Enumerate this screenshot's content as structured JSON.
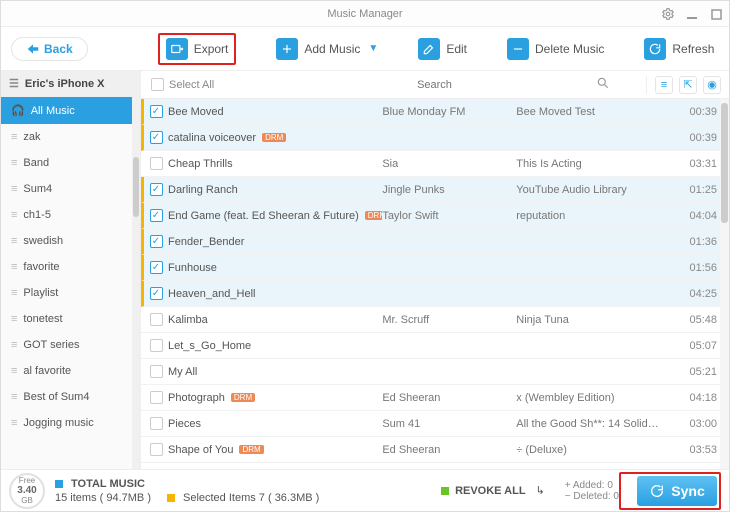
{
  "titlebar": {
    "title": "Music Manager"
  },
  "toolbar": {
    "back": "Back",
    "items": [
      {
        "label": "Export"
      },
      {
        "label": "Add Music"
      },
      {
        "label": "Edit"
      },
      {
        "label": "Delete Music"
      },
      {
        "label": "Refresh"
      }
    ]
  },
  "sidebar": {
    "device": "Eric's iPhone X",
    "items": [
      {
        "label": "All Music",
        "active": true,
        "kind": "music"
      },
      {
        "label": "zak"
      },
      {
        "label": "Band"
      },
      {
        "label": "Sum4"
      },
      {
        "label": "ch1-5"
      },
      {
        "label": "swedish"
      },
      {
        "label": "favorite"
      },
      {
        "label": "Playlist"
      },
      {
        "label": "tonetest"
      },
      {
        "label": "GOT series"
      },
      {
        "label": "al favorite"
      },
      {
        "label": "Best of Sum4"
      },
      {
        "label": "Jogging music"
      }
    ]
  },
  "table": {
    "select_all": "Select All",
    "search_placeholder": "Search",
    "rows": [
      {
        "checked": true,
        "drm": false,
        "title": "Bee Moved",
        "artist": "Blue Monday FM",
        "album": "Bee Moved Test",
        "time": "00:39"
      },
      {
        "checked": true,
        "drm": true,
        "title": "catalina voiceover",
        "artist": "",
        "album": "",
        "time": "00:39"
      },
      {
        "checked": false,
        "drm": false,
        "title": "Cheap Thrills",
        "artist": "Sia",
        "album": "This Is Acting",
        "time": "03:31"
      },
      {
        "checked": true,
        "drm": false,
        "title": "Darling Ranch",
        "artist": "Jingle Punks",
        "album": "YouTube Audio Library",
        "time": "01:25"
      },
      {
        "checked": true,
        "drm": true,
        "title": "End Game (feat. Ed Sheeran & Future)",
        "artist": "Taylor Swift",
        "album": "reputation",
        "time": "04:04"
      },
      {
        "checked": true,
        "drm": false,
        "title": "Fender_Bender",
        "artist": "",
        "album": "",
        "time": "01:36"
      },
      {
        "checked": true,
        "drm": false,
        "title": "Funhouse",
        "artist": "",
        "album": "",
        "time": "01:56"
      },
      {
        "checked": true,
        "drm": false,
        "title": "Heaven_and_Hell",
        "artist": "",
        "album": "",
        "time": "04:25"
      },
      {
        "checked": false,
        "drm": false,
        "title": "Kalimba",
        "artist": "Mr. Scruff",
        "album": "Ninja Tuna",
        "time": "05:48"
      },
      {
        "checked": false,
        "drm": false,
        "title": "Let_s_Go_Home",
        "artist": "",
        "album": "",
        "time": "05:07"
      },
      {
        "checked": false,
        "drm": false,
        "title": "My All",
        "artist": "",
        "album": "",
        "time": "05:21"
      },
      {
        "checked": false,
        "drm": true,
        "title": "Photograph",
        "artist": "Ed Sheeran",
        "album": "x (Wembley Edition)",
        "time": "04:18"
      },
      {
        "checked": false,
        "drm": false,
        "title": "Pieces",
        "artist": "Sum 41",
        "album": "All the Good Sh**: 14 Solid…",
        "time": "03:00"
      },
      {
        "checked": false,
        "drm": true,
        "title": "Shape of You",
        "artist": "Ed Sheeran",
        "album": "÷ (Deluxe)",
        "time": "03:53"
      }
    ]
  },
  "footer": {
    "free_label": "Free",
    "free_value": "3.40",
    "free_unit": "GB",
    "total_label": "TOTAL MUSIC",
    "total_detail": "15 items ( 94.7MB )",
    "selected_detail": "Selected Items 7 ( 36.3MB )",
    "revoke": "REVOKE ALL",
    "added": "Added: 0",
    "deleted": "Deleted: 0",
    "sync": "Sync"
  }
}
